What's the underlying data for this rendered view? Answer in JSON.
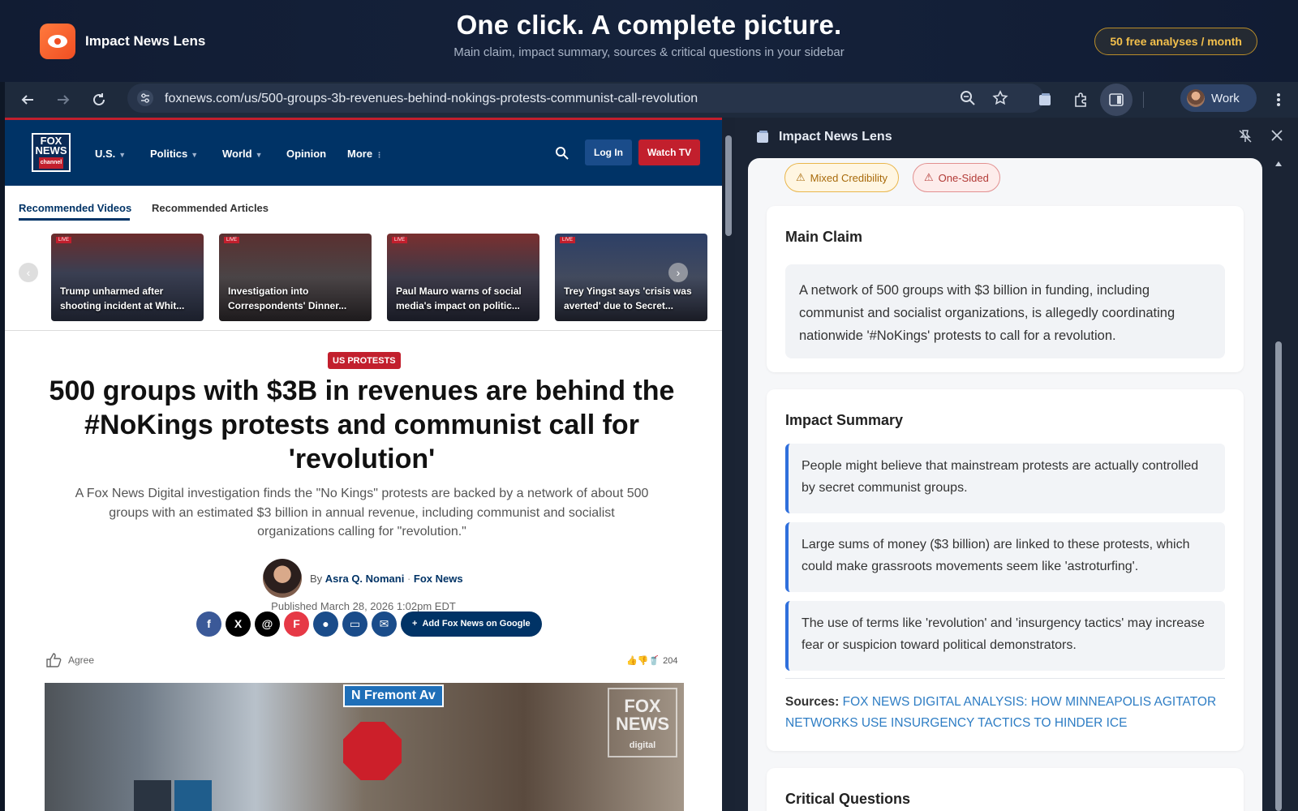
{
  "banner": {
    "brand_name": "Impact News Lens",
    "title": "One click. A complete picture.",
    "subtitle": "Main claim, impact summary, sources & critical questions in your sidebar",
    "badge": "50 free analyses / month"
  },
  "browser": {
    "url": "foxnews.com/us/500-groups-3b-revenues-behind-nokings-protests-communist-call-revolution",
    "profile_name": "Work"
  },
  "site": {
    "logo_line1": "FOX",
    "logo_line2": "NEWS",
    "logo_line3": "channel",
    "nav": [
      "U.S.",
      "Politics",
      "World",
      "Opinion",
      "More"
    ],
    "login_label": "Log In",
    "watch_label": "Watch TV",
    "rec_tabs": [
      "Recommended Videos",
      "Recommended Articles"
    ],
    "videos": [
      {
        "caption": "Trump unharmed after shooting incident at Whit..."
      },
      {
        "caption": "Investigation into Correspondents' Dinner..."
      },
      {
        "caption": "Paul Mauro warns of social media's impact on politic..."
      },
      {
        "caption": "Trey Yingst says 'crisis was averted' due to Secret..."
      }
    ],
    "article": {
      "tag": "US PROTESTS",
      "headline": "500 groups with $3B in revenues are behind the #NoKings protests and communist call for 'revolution'",
      "deck": "A Fox News Digital investigation finds the \"No Kings\" protests are backed by a network of about 500 groups with an estimated $3 billion in annual revenue, including communist and socialist organizations calling for \"revolution.\"",
      "by": "By",
      "author": "Asra Q. Nomani",
      "outlet": "Fox News",
      "published": "Published March 28, 2026 1:02pm EDT",
      "add_google": "Add Fox News on Google",
      "agree": "Agree",
      "reaction_count": "204",
      "hero_street_sign": "N Fremont Av",
      "hero_watermark_1": "FOX",
      "hero_watermark_2": "NEWS",
      "hero_watermark_3": "digital"
    }
  },
  "sidebar": {
    "title": "Impact News Lens",
    "pills": [
      "Mixed Credibility",
      "One-Sided"
    ],
    "main_claim": {
      "heading": "Main Claim",
      "text": "A network of 500 groups with $3 billion in funding, including communist and socialist organizations, is allegedly coordinating nationwide '#NoKings' protests to call for a revolution."
    },
    "impact_summary": {
      "heading": "Impact Summary",
      "items": [
        "People might believe that mainstream protests are actually controlled by secret communist groups.",
        "Large sums of money ($3 billion) are linked to these protests, which could make grassroots movements seem like 'astroturfing'.",
        "The use of terms like 'revolution' and 'insurgency tactics' may increase fear or suspicion toward political demonstrators."
      ]
    },
    "sources": {
      "label": "Sources:",
      "link": "FOX NEWS DIGITAL ANALYSIS: HOW MINNEAPOLIS AGITATOR NETWORKS USE INSURGENCY TACTICS TO HINDER ICE"
    },
    "critical_questions": {
      "heading": "Critical Questions"
    }
  },
  "colors": {
    "accent_blue": "#2f6fdc",
    "fox_navy": "#003366",
    "fox_red": "#c21f2d",
    "badge_gold": "#f3c04c"
  }
}
